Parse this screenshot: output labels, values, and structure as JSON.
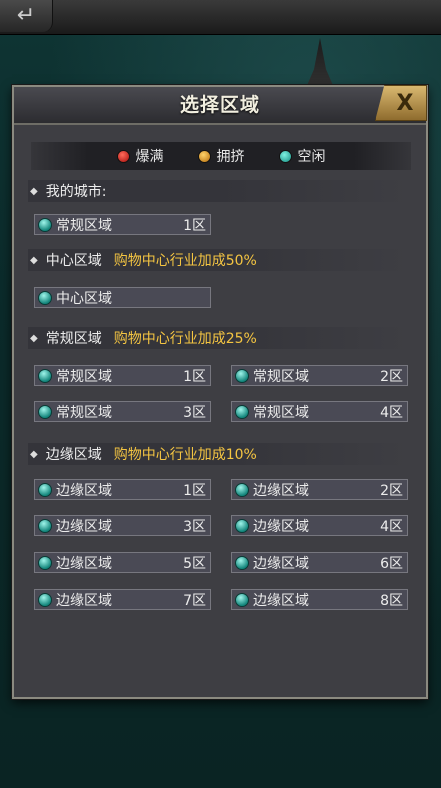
{
  "back_icon": "↵",
  "dialog": {
    "title": "选择区域",
    "close_label": "X"
  },
  "legend": [
    {
      "label": "爆满",
      "color": "#c4180f"
    },
    {
      "label": "拥挤",
      "color": "#e09a1f"
    },
    {
      "label": "空闲",
      "color": "#2fbfb0"
    }
  ],
  "my_city": {
    "label": "我的城市:",
    "zone": {
      "name": "常规区域",
      "num": "1区"
    }
  },
  "center": {
    "label": "中心区域",
    "bonus": "购物中心行业加成50%",
    "zone": {
      "name": "中心区域",
      "num": ""
    }
  },
  "regular": {
    "label": "常规区域",
    "bonus": "购物中心行业加成25%",
    "zones": [
      {
        "name": "常规区域",
        "num": "1区"
      },
      {
        "name": "常规区域",
        "num": "2区"
      },
      {
        "name": "常规区域",
        "num": "3区"
      },
      {
        "name": "常规区域",
        "num": "4区"
      }
    ]
  },
  "edge": {
    "label": "边缘区域",
    "bonus": "购物中心行业加成10%",
    "zones": [
      {
        "name": "边缘区域",
        "num": "1区"
      },
      {
        "name": "边缘区域",
        "num": "2区"
      },
      {
        "name": "边缘区域",
        "num": "3区"
      },
      {
        "name": "边缘区域",
        "num": "4区"
      },
      {
        "name": "边缘区域",
        "num": "5区"
      },
      {
        "name": "边缘区域",
        "num": "6区"
      },
      {
        "name": "边缘区域",
        "num": "7区"
      },
      {
        "name": "边缘区域",
        "num": "8区"
      }
    ]
  }
}
